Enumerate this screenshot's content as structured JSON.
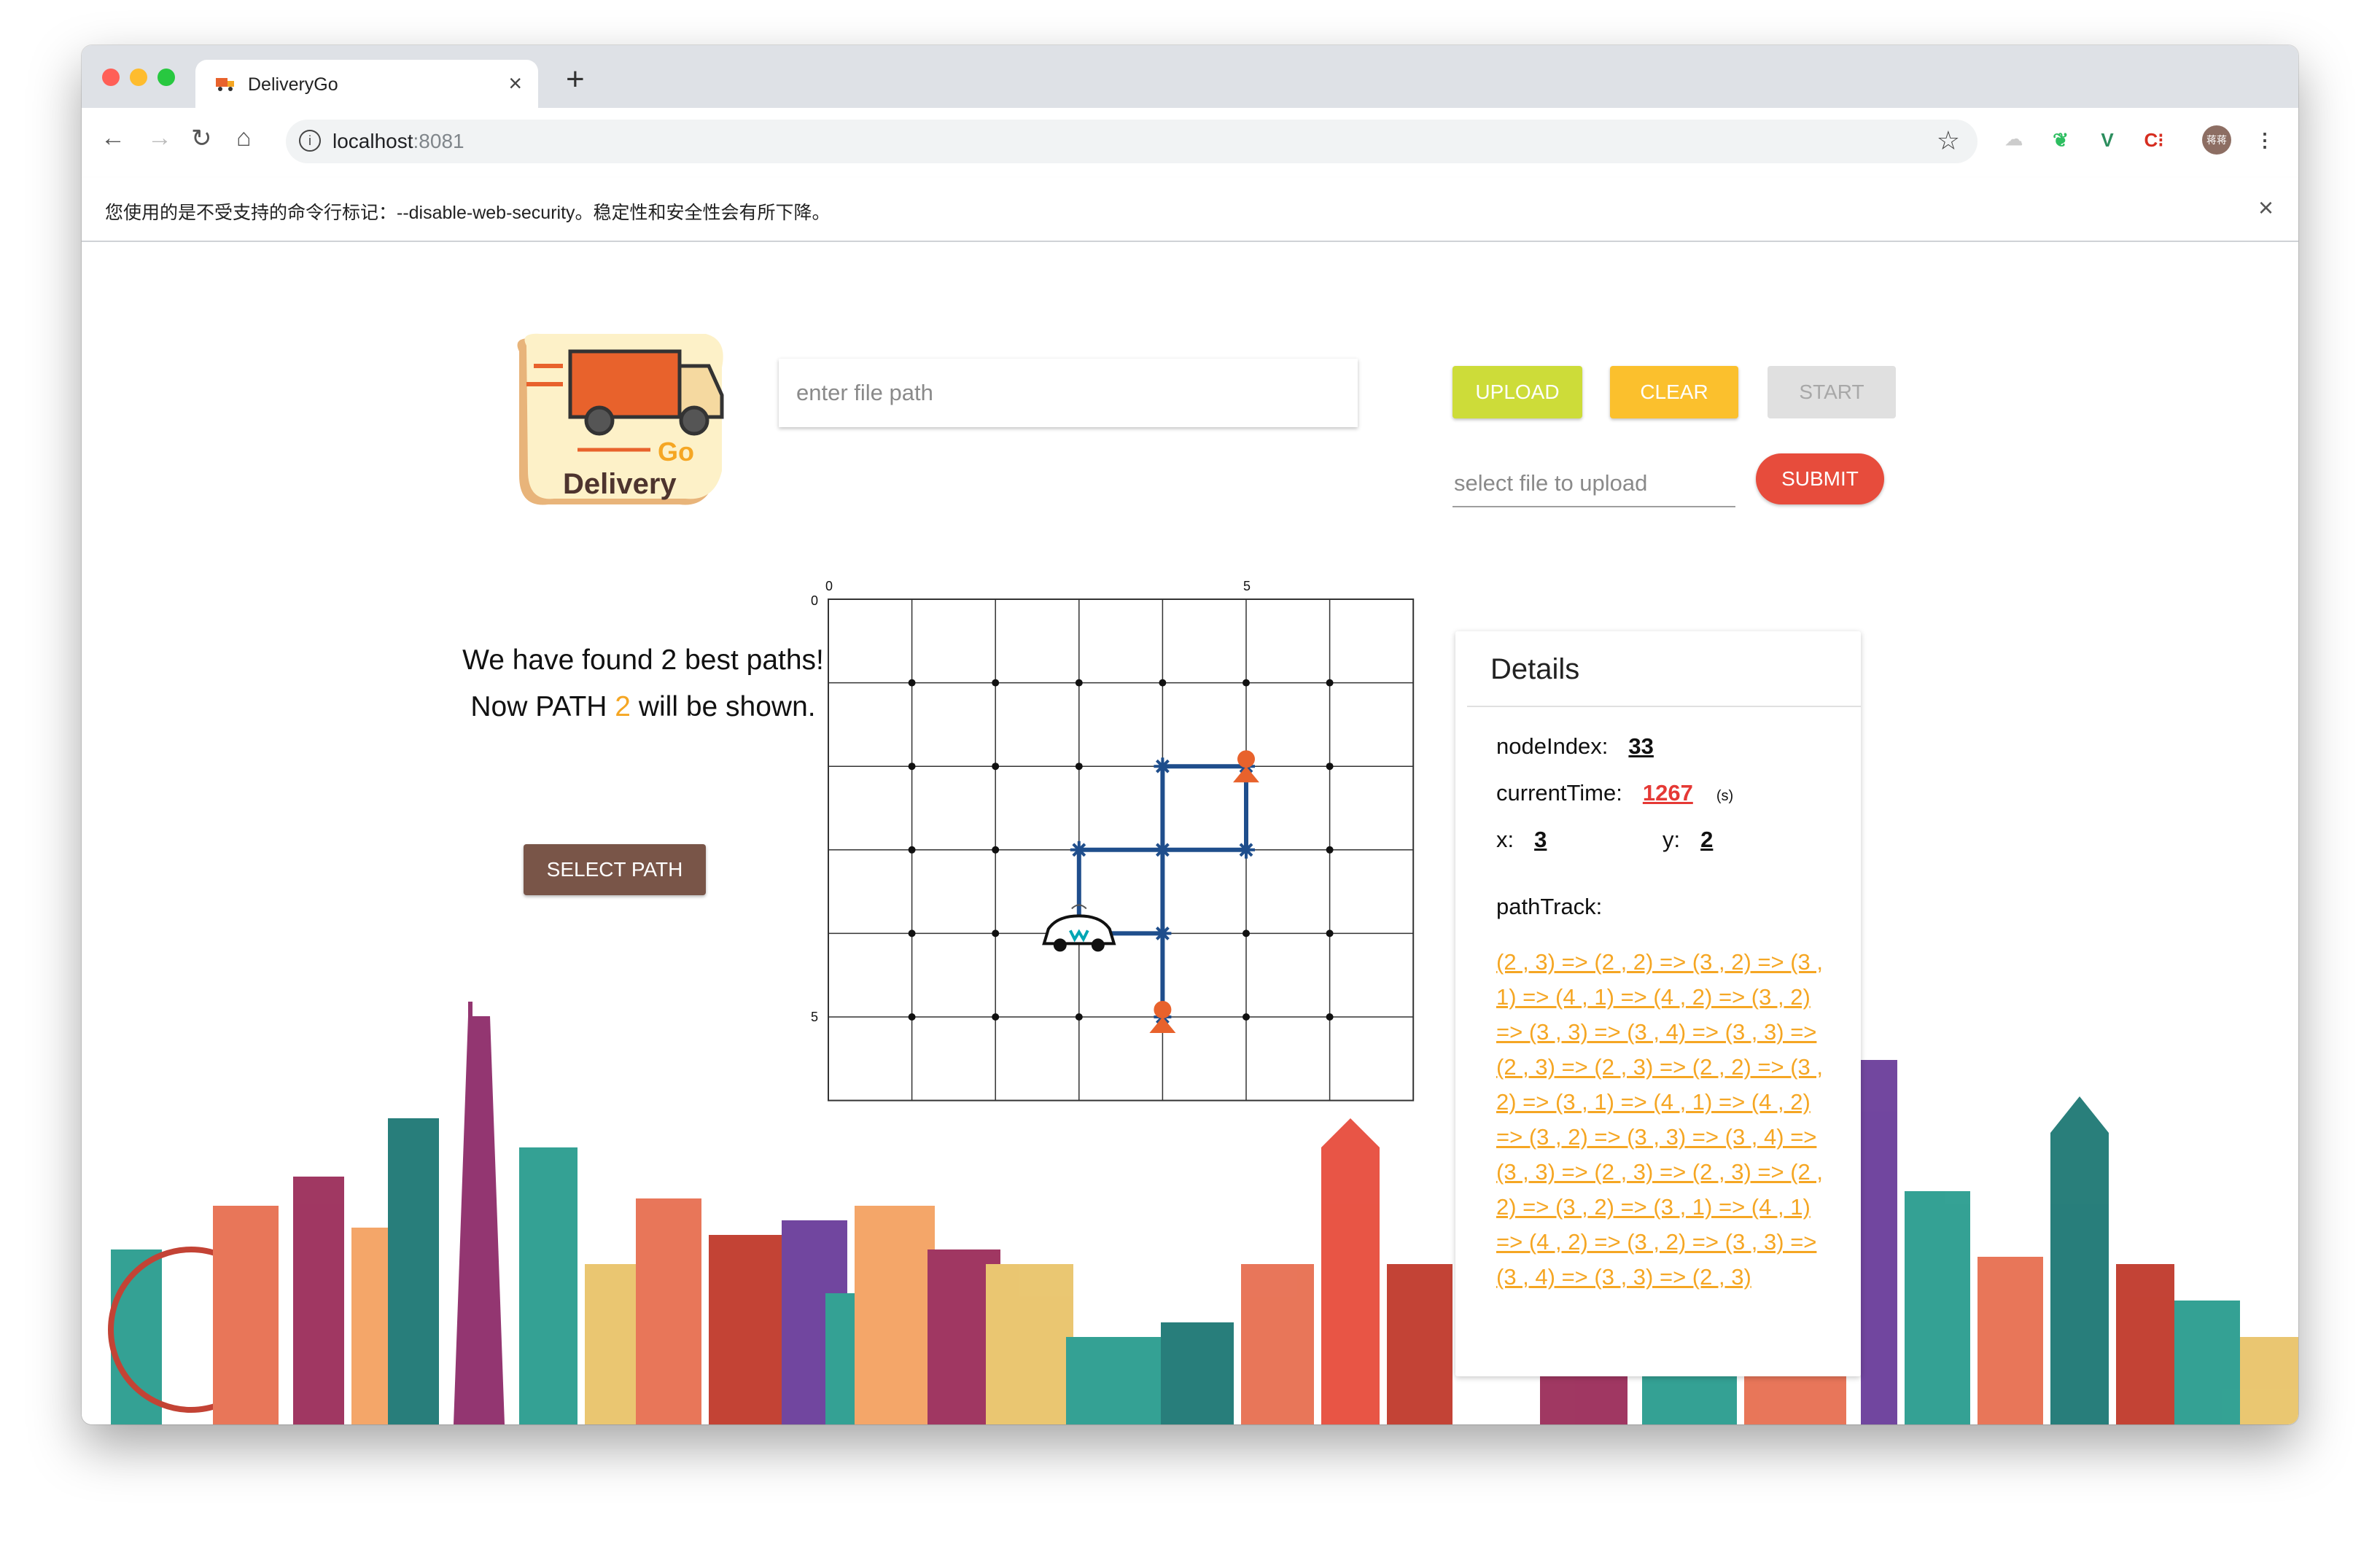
{
  "browser": {
    "tab_title": "DeliveryGo",
    "url_host": "localhost",
    "url_port": ":8081",
    "infobar_text": "您使用的是不受支持的命令行标记：--disable-web-security。稳定性和安全性会有所下降。",
    "avatar_text": "蒋蒋",
    "colors": {
      "traffic_red": "#ff5f57",
      "traffic_yellow": "#febc2e",
      "traffic_green": "#28c840"
    }
  },
  "logo": {
    "go_text": "Go",
    "delivery_text": "Delivery"
  },
  "controls": {
    "file_path_placeholder": "enter file path",
    "upload_label": "UPLOAD",
    "clear_label": "CLEAR",
    "start_label": "START",
    "select_file_placeholder": "select file to upload",
    "submit_label": "SUBMIT"
  },
  "result": {
    "found_text": "We have found 2 best paths!",
    "now_prefix": "Now PATH",
    "path_number": "2",
    "now_suffix": "will be shown.",
    "select_path_label": "SELECT PATH"
  },
  "grid": {
    "x_ticks": [
      "0",
      "5"
    ],
    "y_ticks": [
      "0",
      "5"
    ],
    "cols": 7,
    "rows": 6,
    "path_color": "#1f4e8c",
    "marker_color": "#e8622c",
    "car_position": [
      3,
      4
    ],
    "markers": [
      [
        5,
        2
      ],
      [
        4,
        5
      ]
    ],
    "path_segments": [
      [
        [
          4,
          4
        ],
        [
          3,
          4
        ]
      ],
      [
        [
          3,
          4
        ],
        [
          3,
          3
        ]
      ],
      [
        [
          3,
          3
        ],
        [
          4,
          3
        ]
      ],
      [
        [
          4,
          3
        ],
        [
          5,
          3
        ]
      ],
      [
        [
          5,
          3
        ],
        [
          5,
          2
        ]
      ],
      [
        [
          5,
          2
        ],
        [
          4,
          2
        ]
      ],
      [
        [
          4,
          2
        ],
        [
          4,
          3
        ]
      ],
      [
        [
          4,
          3
        ],
        [
          4,
          4
        ]
      ],
      [
        [
          4,
          4
        ],
        [
          4,
          5
        ]
      ]
    ]
  },
  "details": {
    "title": "Details",
    "node_index_label": "nodeIndex:",
    "node_index": "33",
    "current_time_label": "currentTime:",
    "current_time": "1267",
    "time_unit": "(s)",
    "x_label": "x:",
    "x": "3",
    "y_label": "y:",
    "y": "2",
    "path_track_label": "pathTrack:",
    "path_track": "(2 , 3) => (2 , 2) => (3 , 2) => (3 , 1) => (4 , 1) => (4 , 2) => (3 , 2) => (3 , 3) => (3 , 4) => (3 , 3) => (2 , 3) => (2 , 3) => (2 , 2) => (3 , 2) => (3 , 1) => (4 , 1) => (4 , 2) => (3 , 2) => (3 , 3) => (3 , 4) => (3 , 3) => (2 , 3) => (2 , 3) => (2 , 2) => (3 , 2) => (3 , 1) => (4 , 1) => (4 , 2) => (3 , 2) => (3 , 3) => (3 , 4) => (3 , 3) => (2 , 3)"
  }
}
